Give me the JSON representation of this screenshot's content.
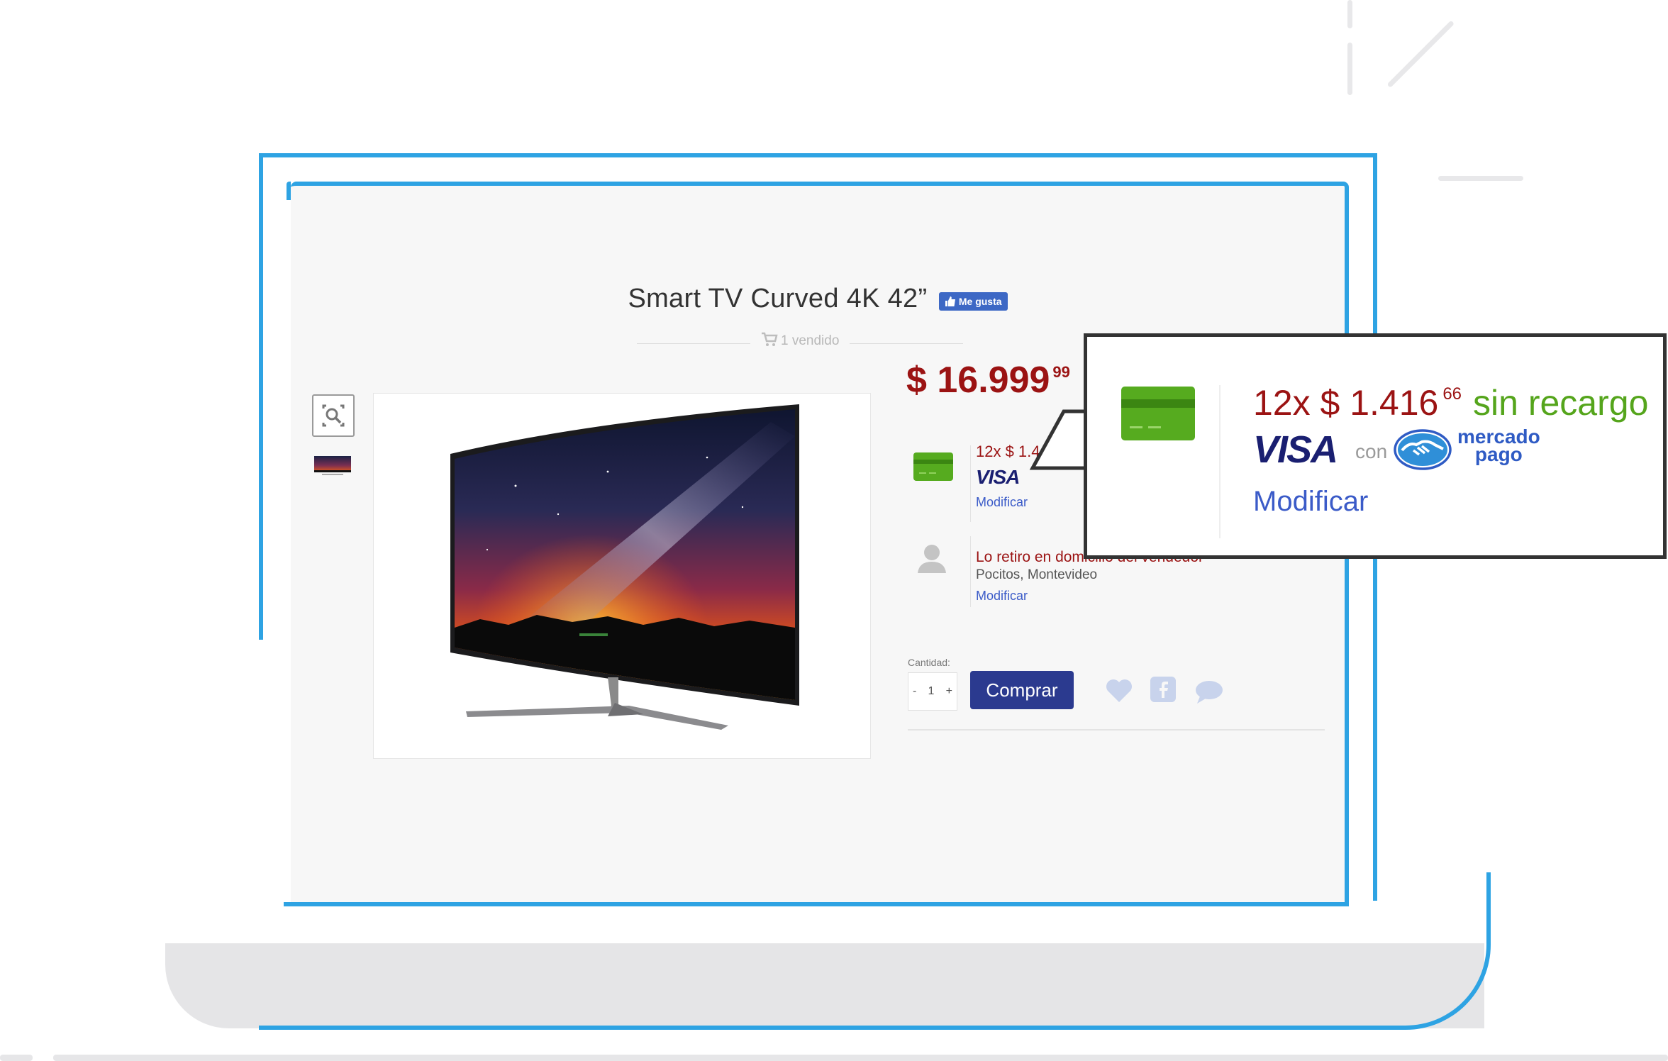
{
  "product": {
    "title": "Smart TV Curved 4K 42”",
    "like_label": "Me gusta",
    "sold_label": "1 vendido",
    "price_main": "$ 16.999",
    "price_cents": "99"
  },
  "payment": {
    "installments_short": "12x $ 1.4",
    "card_brand": "VISA",
    "modify_label": "Modificar"
  },
  "pickup": {
    "title": "Lo retiro en domicilio del vendedor",
    "location": "Pocitos, Montevideo",
    "modify_label": "Modificar"
  },
  "purchase": {
    "quantity_label": "Cantidad:",
    "quantity_minus": "-",
    "quantity_value": "1",
    "quantity_plus": "+",
    "buy_label": "Comprar"
  },
  "callout": {
    "installments_prefix": "12x $ 1.416",
    "installments_cents": "66",
    "installments_suffix": "sin recargo",
    "card_brand": "VISA",
    "con_label": "con",
    "mp_line1": "mercado",
    "mp_line2": "pago",
    "modify_label": "Modificar"
  },
  "colors": {
    "frame_blue": "#2ea3e3",
    "price_red": "#9b1313",
    "accent_green": "#55a51c",
    "buy_button": "#2b3a8f",
    "link_blue": "#3b5bc8"
  },
  "icons": [
    "zoom-icon",
    "credit-card-icon",
    "user-icon",
    "cart-icon",
    "heart-icon",
    "facebook-icon",
    "comment-icon",
    "thumbs-up-icon",
    "handshake-icon"
  ]
}
